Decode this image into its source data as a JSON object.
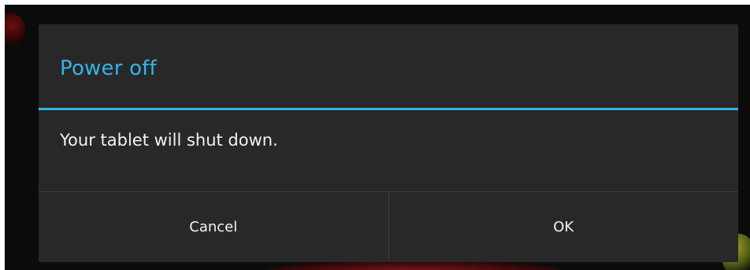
{
  "dialog": {
    "title": "Power off",
    "message": "Your tablet will shut down.",
    "accent_color": "#33b5e5",
    "buttons": {
      "cancel_label": "Cancel",
      "ok_label": "OK"
    }
  }
}
